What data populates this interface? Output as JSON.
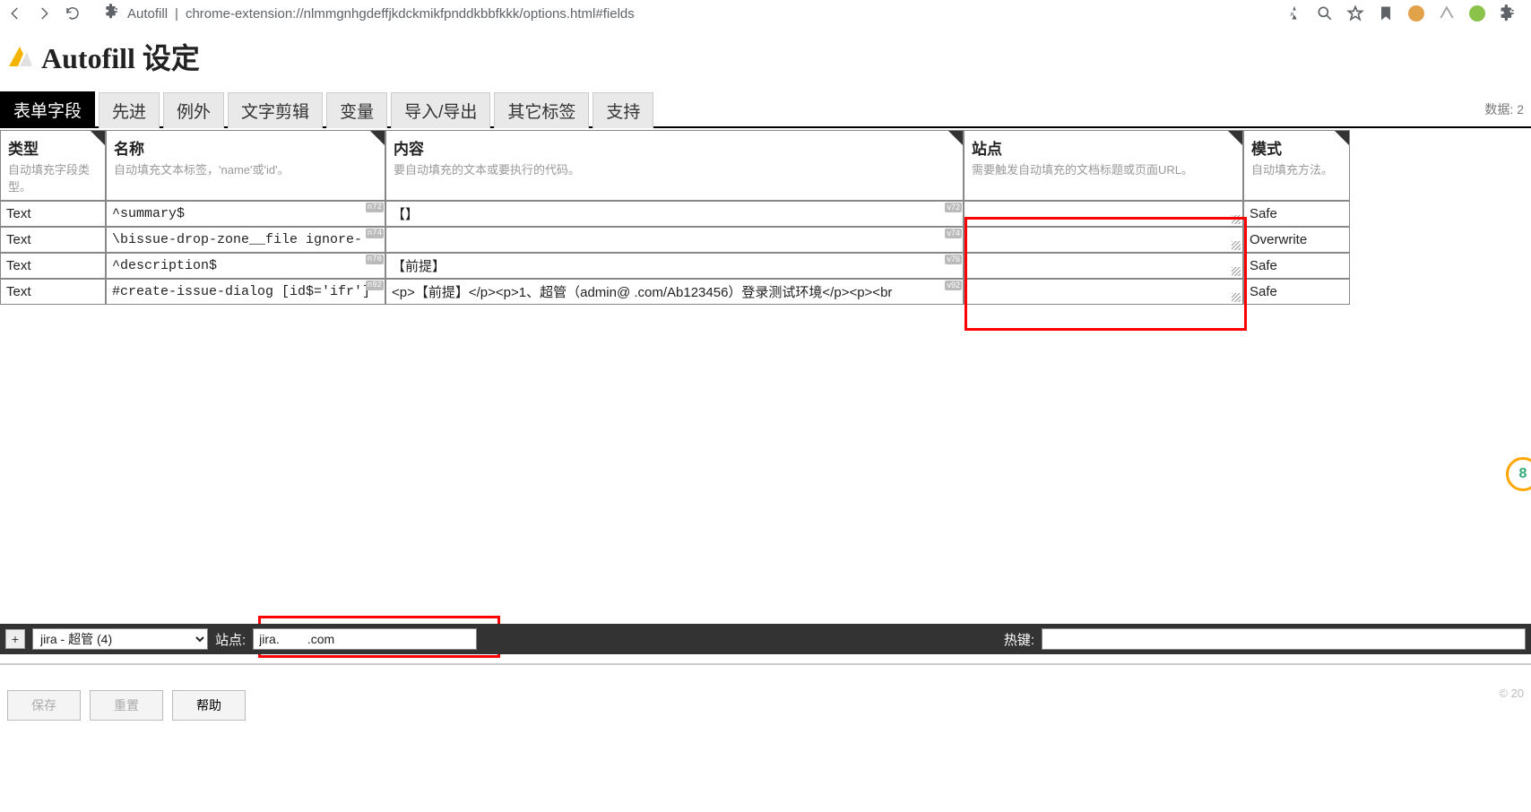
{
  "browser": {
    "ext_name": "Autofill",
    "url": "chrome-extension://nlmmgnhgdeffjkdckmikfpnddkbbfkkk/options.html#fields"
  },
  "header": {
    "title": "Autofill 设定"
  },
  "tabs": {
    "items": [
      "表单字段",
      "先进",
      "例外",
      "文字剪辑",
      "变量",
      "导入/导出",
      "其它标签",
      "支持"
    ],
    "right_text": "数据: 2"
  },
  "columns": {
    "type": {
      "title": "类型",
      "desc": "自动填充字段类型。"
    },
    "name": {
      "title": "名称",
      "desc": "自动填充文本标签，'name'或'id'。"
    },
    "content": {
      "title": "内容",
      "desc": "要自动填充的文本或要执行的代码。"
    },
    "site": {
      "title": "站点",
      "desc": "需要触发自动填充的文档标题或页面URL。"
    },
    "mode": {
      "title": "模式",
      "desc": "自动填充方法。"
    }
  },
  "rows": [
    {
      "type": "Text",
      "name": "^summary$",
      "name_tag": "n72",
      "content": "【】",
      "content_tag": "v72",
      "site": "",
      "mode": "Safe"
    },
    {
      "type": "Text",
      "name": "\\bissue-drop-zone__file ignore-",
      "name_tag": "n74",
      "content": "",
      "content_tag": "v74",
      "site": "",
      "mode": "Overwrite"
    },
    {
      "type": "Text",
      "name": "^description$",
      "name_tag": "n76",
      "content": "【前提】",
      "content_tag": "v76",
      "site": "",
      "mode": "Safe"
    },
    {
      "type": "Text",
      "name": "#create-issue-dialog  [id$='ifr']",
      "name_tag": "n92",
      "content": "<p>【前提】</p><p>1、超管（admin@         .com/Ab123456）登录测试环境</p><p><br",
      "content_tag": "v92",
      "site": "",
      "mode": "Safe"
    }
  ],
  "bottom": {
    "plus": "+",
    "profile": "jira - 超管 (4)",
    "site_label": "站点:",
    "site_value": "jira.        .com",
    "hotkey_label": "热键:",
    "hotkey_value": ""
  },
  "footer": {
    "save": "保存",
    "reset": "重置",
    "help": "帮助",
    "copyright": "© 20"
  },
  "side_badge": "8"
}
